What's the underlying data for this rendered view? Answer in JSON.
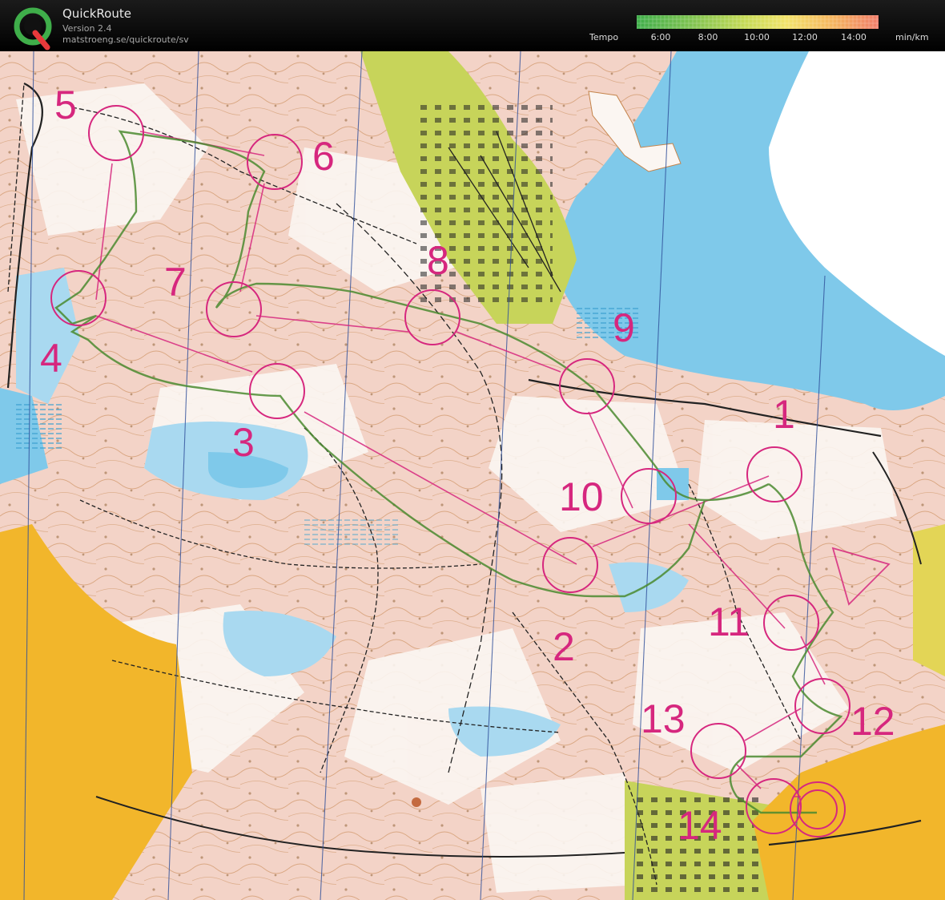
{
  "app": {
    "name": "QuickRoute",
    "version": "Version 2.4",
    "url": "matstroeng.se/quickroute/sv"
  },
  "legend": {
    "title": "Tempo",
    "unit": "min/km",
    "ticks": [
      "6:00",
      "8:00",
      "10:00",
      "12:00",
      "14:00"
    ],
    "gradient": [
      "#3fae4a",
      "#7cc24f",
      "#c6da55",
      "#f3e36a",
      "#f5b25e",
      "#f07d6a"
    ]
  },
  "map": {
    "controls": [
      "1",
      "2",
      "3",
      "4",
      "5",
      "6",
      "7",
      "8",
      "9",
      "10",
      "11",
      "12",
      "13",
      "14"
    ],
    "colors": {
      "terrain": "#f3d3c7",
      "forest": "#ffffff",
      "water": "#7fc9ea",
      "lake": "#a9d9f0",
      "open_land": "#f2b62b",
      "settlement": "#c7d45a",
      "course": "#d6277e",
      "route": "#4a8a2f",
      "contour": "#b5692f",
      "north_line": "#2f4f9a"
    }
  }
}
